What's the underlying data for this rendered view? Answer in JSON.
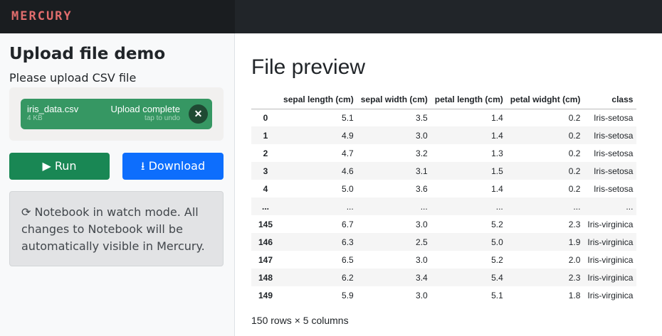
{
  "app": {
    "logo": "MERCURY"
  },
  "sidebar": {
    "title": "Upload file demo",
    "prompt": "Please upload CSV file",
    "file": {
      "name": "iris_data.csv",
      "size": "4 KB",
      "status": "Upload complete",
      "undo": "tap to undo"
    },
    "run_label": "Run",
    "download_label": "Download",
    "alert": "Notebook in watch mode. All changes to Notebook will be automatically visible in Mercury."
  },
  "main": {
    "title": "File preview",
    "columns": [
      "",
      "sepal length (cm)",
      "sepal width (cm)",
      "petal length (cm)",
      "petal widght (cm)",
      "class"
    ],
    "rows": [
      [
        "0",
        "5.1",
        "3.5",
        "1.4",
        "0.2",
        "Iris-setosa"
      ],
      [
        "1",
        "4.9",
        "3.0",
        "1.4",
        "0.2",
        "Iris-setosa"
      ],
      [
        "2",
        "4.7",
        "3.2",
        "1.3",
        "0.2",
        "Iris-setosa"
      ],
      [
        "3",
        "4.6",
        "3.1",
        "1.5",
        "0.2",
        "Iris-setosa"
      ],
      [
        "4",
        "5.0",
        "3.6",
        "1.4",
        "0.2",
        "Iris-setosa"
      ],
      [
        "...",
        "...",
        "...",
        "...",
        "...",
        "..."
      ],
      [
        "145",
        "6.7",
        "3.0",
        "5.2",
        "2.3",
        "Iris-virginica"
      ],
      [
        "146",
        "6.3",
        "2.5",
        "5.0",
        "1.9",
        "Iris-virginica"
      ],
      [
        "147",
        "6.5",
        "3.0",
        "5.2",
        "2.0",
        "Iris-virginica"
      ],
      [
        "148",
        "6.2",
        "3.4",
        "5.4",
        "2.3",
        "Iris-virginica"
      ],
      [
        "149",
        "5.9",
        "3.0",
        "5.1",
        "1.8",
        "Iris-virginica"
      ]
    ],
    "footer": "150 rows × 5 columns"
  }
}
